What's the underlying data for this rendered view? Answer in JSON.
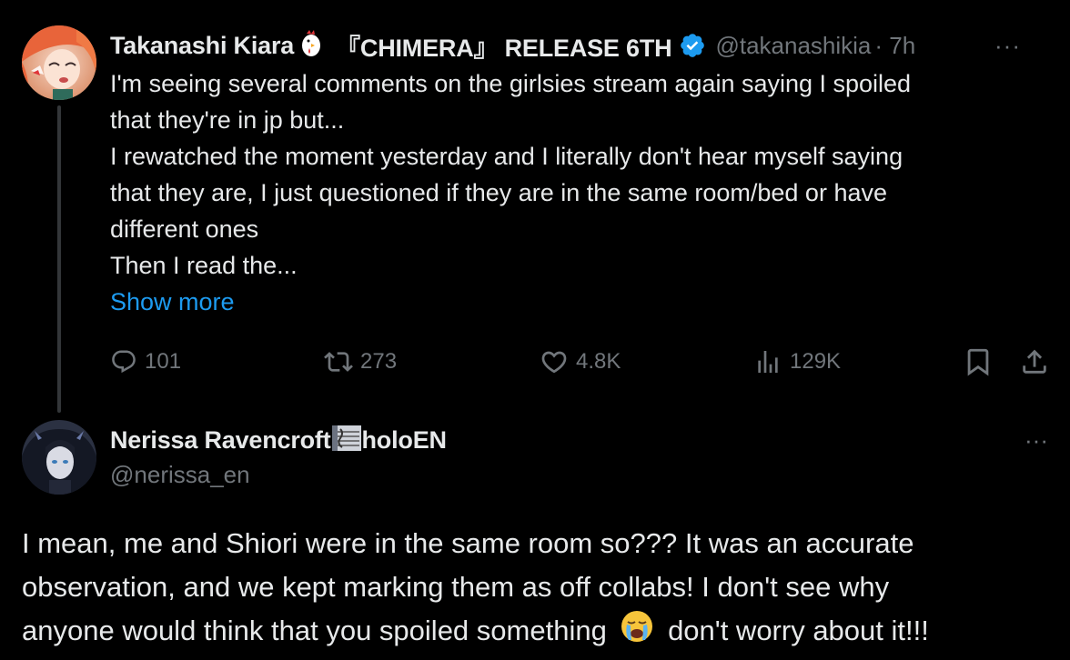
{
  "tweet": {
    "author_name": "Takanashi Kiara",
    "author_name_suffix": "『CHIMERA』 RELEASE 6TH",
    "handle": "@takanashikia",
    "time": "· 7h",
    "lines": [
      "I'm seeing several comments on the girlsies stream again saying I spoiled",
      "that they're in jp but...",
      "I rewatched the moment yesterday and I literally don't hear myself saying",
      "that they are, I just questioned if they are in the same room/bed or have",
      "different ones",
      "Then I read the..."
    ],
    "show_more": "Show more",
    "more_icon": "more-dots-icon",
    "more_text": "···",
    "stats": {
      "replies": "101",
      "retweets": "273",
      "likes": "4.8K",
      "views": "129K"
    }
  },
  "reply": {
    "author_name": "Nerissa Ravencroft",
    "author_name_suffix": "holoEN",
    "handle": "@nerissa_en",
    "more_text": "···",
    "lines": [
      "I mean, me and Shiori were in the same room so??? It was an accurate",
      "observation, and we kept marking them as off collabs! I don't see why"
    ],
    "last_line_before": "anyone would think that you spoiled something",
    "last_line_after": "don't worry about it!!!"
  },
  "colors": {
    "background": "#000000",
    "text": "#e7e9ea",
    "secondary": "#71767b",
    "link": "#1d9bf0",
    "thread_line": "#333639"
  }
}
